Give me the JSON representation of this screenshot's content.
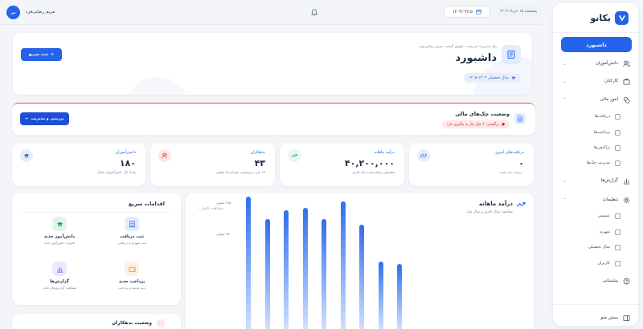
{
  "sidebar": {
    "logo_text": "یکانو",
    "dashboard_label": "داشبورد",
    "items": [
      {
        "label": "دانش‌آموزان"
      },
      {
        "label": "کارکنان"
      },
      {
        "label": "امور مالی"
      },
      {
        "label": "گزارش‌ها"
      },
      {
        "label": "تنظیمات"
      },
      {
        "label": "پشتیبانی"
      }
    ],
    "finance_sub": [
      "دریافت‌ها",
      "پرداخت‌ها",
      "تراکنش‌ها",
      "مدیریت چک‌ها"
    ],
    "settings_sub": [
      "عمومی",
      "شهریه",
      "سال تحصیلی",
      "کاربران"
    ],
    "close_menu": "بستن منو"
  },
  "header": {
    "date_text": "پنجشنبه ۱۵ خرداد ۱۴۰۴",
    "date_value": "۱۴۰۴/۰۳/۱۵",
    "user_name": "مریم رضایی‌فرد",
    "avatar_initials": "مر"
  },
  "hero": {
    "breadcrumb": "پنل مدیریت مدرسه · خوش آمدید، مریم رضایی‌فرد",
    "title": "داشبورد",
    "year_label": "سال تحصیلی ۱۴۰۴-۱۴۰۵",
    "quick_button": "ثبت سریع"
  },
  "cheque": {
    "title": "وضعیت چک‌های مالی",
    "badge": "برگشتی: ۳ چک نیاز به پیگیری دارد",
    "button": "بررسی و مدیریت"
  },
  "stats": [
    {
      "label": "دریافت‌های امروز",
      "value": "۰",
      "sub": "۰ رسید ثبت شده",
      "color": "#e8eef9",
      "icon_color": "#2563eb"
    },
    {
      "label": "درآمد ماهانه",
      "value": "۴۰,۲۰۰,۰۰۰",
      "sub": "مجموع دریافت‌شده ماه جاری",
      "color": "#e6f7ee",
      "icon_color": "#16a34a"
    },
    {
      "label": "بدهکاران",
      "value": "۴۳",
      "sub": "۱۷ نفر در وضعیت بحرانی",
      "color": "#fde8e8",
      "icon_color": "#dc2626"
    },
    {
      "label": "دانش‌آموزان",
      "value": "۱۸۰",
      "sub": "تعداد کل دانش‌آموزان فعال",
      "color": "#e8eef9",
      "icon_color": "#2563eb"
    }
  ],
  "revenue": {
    "title": "درآمد ماهانه",
    "subtitle": "مقایسه سال جاری و سال قبل",
    "link": "مشاهده کامل"
  },
  "chart_data": {
    "type": "bar",
    "categories": [
      "",
      "",
      "",
      "",
      "",
      "",
      "",
      "",
      "",
      ""
    ],
    "values": [
      395,
      370,
      380,
      382,
      370,
      390,
      363,
      321,
      319,
      0
    ],
    "y_ticks": [
      {
        "value": 420,
        "label": "۴۲۰ میلیون"
      },
      {
        "value": 385,
        "label": "۳۸۵ میلیون"
      },
      {
        "value": 350,
        "label": "۳۵۰ میلیون"
      }
    ],
    "ylim": [
      245,
      445
    ],
    "title": "درآمد ماهانه",
    "xlabel": "",
    "ylabel": ""
  },
  "quick_actions": {
    "title": "اقدامات سریع",
    "tiles": [
      {
        "label": "ثبت دریافت",
        "sub": "ثبت شهریه و دریافتی",
        "bg": "#e3ecfd",
        "fg": "#2563eb"
      },
      {
        "label": "دانش‌آموز جدید",
        "sub": "افزودن دانش‌آموز جدید",
        "bg": "#e0f5ec",
        "fg": "#16a34a"
      },
      {
        "label": "پرداخت جدید",
        "sub": "ثبت هزینه و پرداخت",
        "bg": "#fdf0e0",
        "fg": "#ea8a1a"
      },
      {
        "label": "گزارش‌ها",
        "sub": "مشاهده گزارش‌های مالی",
        "bg": "#efe7fd",
        "fg": "#7c3aed"
      }
    ]
  },
  "debtors": {
    "title": "وضعیت بدهکاران"
  }
}
